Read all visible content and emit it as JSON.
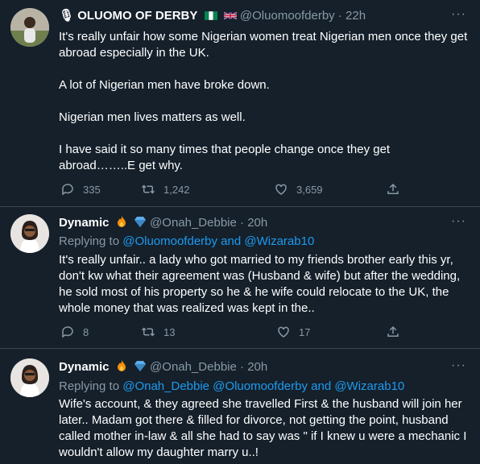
{
  "tweets": [
    {
      "display_name": "🎙 OLUOMO OF DERBY",
      "handle": "@Oluomoofderby",
      "separator": "·",
      "time": "22h",
      "paragraphs": [
        "It's really unfair how some Nigerian women treat Nigerian men once they get abroad especially in the UK.",
        "A lot of Nigerian men have broke down.",
        "Nigerian men lives matters as well.",
        "I have said it so many times that people change once they get abroad……..E get why."
      ],
      "replies": "335",
      "retweets": "1,242",
      "likes": "3,659"
    },
    {
      "display_name": "Dynamic",
      "handle": "@Onah_Debbie",
      "separator": "·",
      "time": "20h",
      "replying_prefix": "Replying to",
      "replying_to": "@Oluomoofderby and @Wizarab10",
      "text": "It's really unfair.. a lady who got married to my friends brother early this yr, don't kw what their agreement was (Husband & wife) but after the wedding, he sold most of his property so he & he wife could relocate to the UK, the whole money that was realized was kept in the..",
      "replies": "8",
      "retweets": "13",
      "likes": "17"
    },
    {
      "display_name": "Dynamic",
      "handle": "@Onah_Debbie",
      "separator": "·",
      "time": "20h",
      "replying_prefix": "Replying to",
      "replying_to": "@Onah_Debbie @Oluomoofderby and @Wizarab10",
      "text": "Wife's account, & they agreed she travelled First & the husband will join her later.. Madam got there & filled for divorce, not getting the point, husband called mother in-law & all she had to say was \" if I knew u were a mechanic I wouldn't allow my daughter marry u..!"
    }
  ],
  "icons": {
    "reply": "reply-icon",
    "retweet": "retweet-icon",
    "like": "heart-icon",
    "share": "share-icon",
    "more": "more-icon"
  },
  "colors": {
    "background": "#15202b",
    "link": "#1d9bf0",
    "muted": "#8899a6",
    "divider": "#38444d"
  }
}
